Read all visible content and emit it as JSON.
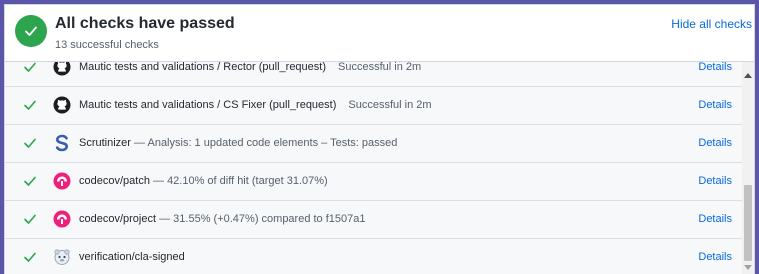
{
  "header": {
    "title": "All checks have passed",
    "subtitle": "13 successful checks",
    "hide_all_label": "Hide all checks",
    "status_color": "#2da44e"
  },
  "checks": [
    {
      "icon": "github-icon",
      "name": "Mautic tests and validations / Rector (pull_request)",
      "separator": "",
      "description": "Successful in 2m",
      "details_label": "Details"
    },
    {
      "icon": "github-icon",
      "name": "Mautic tests and validations / CS Fixer (pull_request)",
      "separator": "",
      "description": "Successful in 2m",
      "details_label": "Details"
    },
    {
      "icon": "scrutinizer-icon",
      "name": "Scrutinizer",
      "separator": " — ",
      "description": "Analysis: 1 updated code elements – Tests: passed",
      "details_label": "Details"
    },
    {
      "icon": "codecov-icon",
      "name": "codecov/patch",
      "separator": " — ",
      "description": "42.10% of diff hit (target 31.07%)",
      "details_label": "Details"
    },
    {
      "icon": "codecov-icon",
      "name": "codecov/project",
      "separator": " — ",
      "description": "31.55% (+0.47%) compared to f1507a1",
      "details_label": "Details"
    },
    {
      "icon": "cla-bot-icon",
      "name": "verification/cla-signed",
      "separator": "",
      "description": "",
      "details_label": "Details"
    }
  ],
  "colors": {
    "success": "#2da44e",
    "link": "#0969da",
    "codecov": "#f01f7a",
    "scrutinizer": "#3b5dab"
  }
}
